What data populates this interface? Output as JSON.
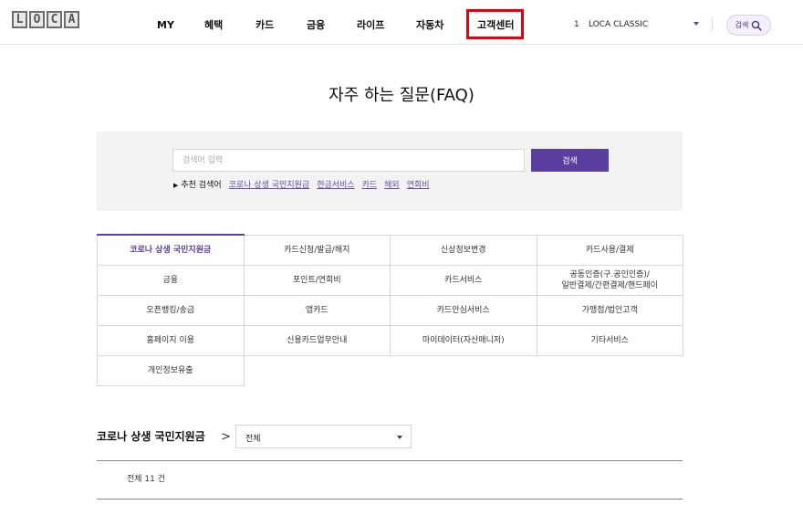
{
  "header": {
    "logo_letters": [
      "L",
      "O",
      "C",
      "A"
    ],
    "nav": [
      {
        "label": "MY"
      },
      {
        "label": "혜택"
      },
      {
        "label": "카드"
      },
      {
        "label": "금융"
      },
      {
        "label": "라이프"
      },
      {
        "label": "자동차"
      },
      {
        "label": "고객센터"
      }
    ],
    "card_number": "1",
    "card_name": "LOCA CLASSIC",
    "search_label": "검색"
  },
  "page": {
    "title": "자주 하는 질문(FAQ)"
  },
  "search": {
    "placeholder": "검색어 입력",
    "button_label": "검색",
    "recommended_label": "추천 검색어",
    "recommended": [
      "코로나 상생 국민지원금",
      "현금서비스",
      "카드",
      "해외",
      "연회비"
    ]
  },
  "categories": {
    "rows": [
      [
        "코로나 상생 국민지원금",
        "카드신청/발급/해지",
        "신상정보변경",
        "카드사용/결제"
      ],
      [
        "금융",
        "포인트/연회비",
        "카드서비스",
        "공동인증(구.공인인증)/\n일반결제/간편결제/핸드페이"
      ],
      [
        "오픈뱅킹/송금",
        "앱카드",
        "카드안심서비스",
        "가맹점/법인고객"
      ],
      [
        "홈페이지 이용",
        "신용카드업무안내",
        "마이데이터(자산매니저)",
        "기타서비스"
      ],
      [
        "개인정보유출"
      ]
    ]
  },
  "section": {
    "title": "코로나 상생 국민지원금",
    "filter_value": "전체",
    "total": "전체 11 건"
  },
  "colors": {
    "accent": "#5a3ea0",
    "highlight_box": "#e8000b"
  }
}
